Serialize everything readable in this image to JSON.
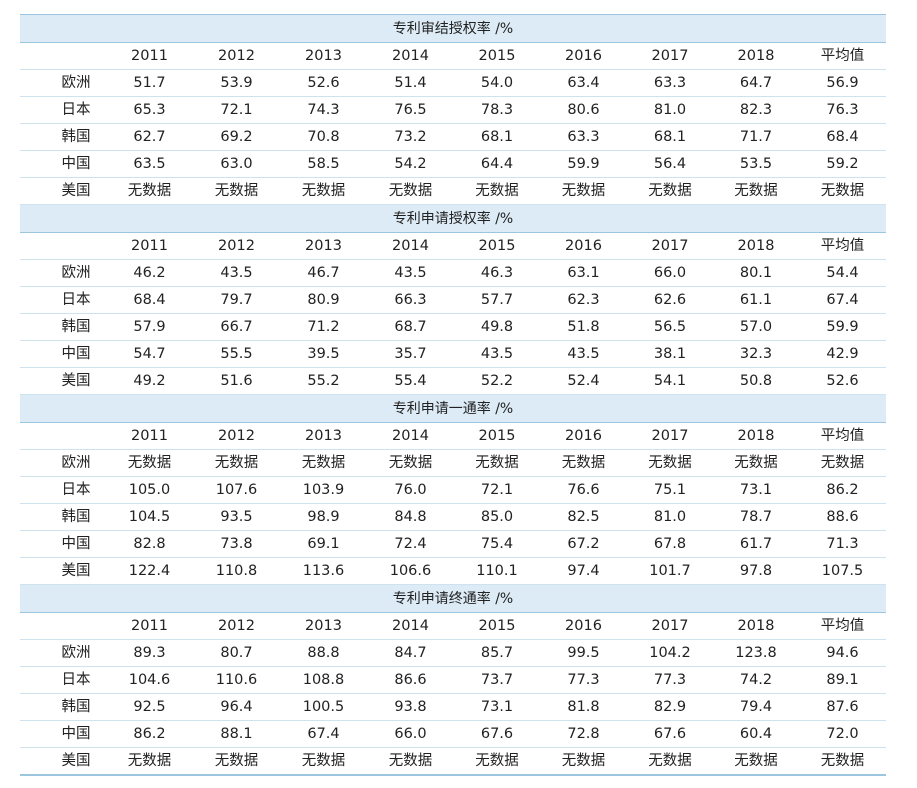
{
  "columns": [
    "2011",
    "2012",
    "2013",
    "2014",
    "2015",
    "2016",
    "2017",
    "2018",
    "平均值"
  ],
  "sections": [
    {
      "title": "专利审结授权率 /%",
      "rows": [
        {
          "region": "欧洲",
          "values": [
            "51.7",
            "53.9",
            "52.6",
            "51.4",
            "54.0",
            "63.4",
            "63.3",
            "64.7",
            "56.9"
          ]
        },
        {
          "region": "日本",
          "values": [
            "65.3",
            "72.1",
            "74.3",
            "76.5",
            "78.3",
            "80.6",
            "81.0",
            "82.3",
            "76.3"
          ]
        },
        {
          "region": "韩国",
          "values": [
            "62.7",
            "69.2",
            "70.8",
            "73.2",
            "68.1",
            "63.3",
            "68.1",
            "71.7",
            "68.4"
          ]
        },
        {
          "region": "中国",
          "values": [
            "63.5",
            "63.0",
            "58.5",
            "54.2",
            "64.4",
            "59.9",
            "56.4",
            "53.5",
            "59.2"
          ]
        },
        {
          "region": "美国",
          "values": [
            "无数据",
            "无数据",
            "无数据",
            "无数据",
            "无数据",
            "无数据",
            "无数据",
            "无数据",
            "无数据"
          ]
        }
      ]
    },
    {
      "title": "专利申请授权率 /%",
      "rows": [
        {
          "region": "欧洲",
          "values": [
            "46.2",
            "43.5",
            "46.7",
            "43.5",
            "46.3",
            "63.1",
            "66.0",
            "80.1",
            "54.4"
          ]
        },
        {
          "region": "日本",
          "values": [
            "68.4",
            "79.7",
            "80.9",
            "66.3",
            "57.7",
            "62.3",
            "62.6",
            "61.1",
            "67.4"
          ]
        },
        {
          "region": "韩国",
          "values": [
            "57.9",
            "66.7",
            "71.2",
            "68.7",
            "49.8",
            "51.8",
            "56.5",
            "57.0",
            "59.9"
          ]
        },
        {
          "region": "中国",
          "values": [
            "54.7",
            "55.5",
            "39.5",
            "35.7",
            "43.5",
            "43.5",
            "38.1",
            "32.3",
            "42.9"
          ]
        },
        {
          "region": "美国",
          "values": [
            "49.2",
            "51.6",
            "55.2",
            "55.4",
            "52.2",
            "52.4",
            "54.1",
            "50.8",
            "52.6"
          ]
        }
      ]
    },
    {
      "title": "专利申请一通率 /%",
      "rows": [
        {
          "region": "欧洲",
          "values": [
            "无数据",
            "无数据",
            "无数据",
            "无数据",
            "无数据",
            "无数据",
            "无数据",
            "无数据",
            "无数据"
          ]
        },
        {
          "region": "日本",
          "values": [
            "105.0",
            "107.6",
            "103.9",
            "76.0",
            "72.1",
            "76.6",
            "75.1",
            "73.1",
            "86.2"
          ]
        },
        {
          "region": "韩国",
          "values": [
            "104.5",
            "93.5",
            "98.9",
            "84.8",
            "85.0",
            "82.5",
            "81.0",
            "78.7",
            "88.6"
          ]
        },
        {
          "region": "中国",
          "values": [
            "82.8",
            "73.8",
            "69.1",
            "72.4",
            "75.4",
            "67.2",
            "67.8",
            "61.7",
            "71.3"
          ]
        },
        {
          "region": "美国",
          "values": [
            "122.4",
            "110.8",
            "113.6",
            "106.6",
            "110.1",
            "97.4",
            "101.7",
            "97.8",
            "107.5"
          ]
        }
      ]
    },
    {
      "title": "专利申请终通率 /%",
      "rows": [
        {
          "region": "欧洲",
          "values": [
            "89.3",
            "80.7",
            "88.8",
            "84.7",
            "85.7",
            "99.5",
            "104.2",
            "123.8",
            "94.6"
          ]
        },
        {
          "region": "日本",
          "values": [
            "104.6",
            "110.6",
            "108.8",
            "86.6",
            "73.7",
            "77.3",
            "77.3",
            "74.2",
            "89.1"
          ]
        },
        {
          "region": "韩国",
          "values": [
            "92.5",
            "96.4",
            "100.5",
            "93.8",
            "73.1",
            "81.8",
            "82.9",
            "79.4",
            "87.6"
          ]
        },
        {
          "region": "中国",
          "values": [
            "86.2",
            "88.1",
            "67.4",
            "66.0",
            "67.6",
            "72.8",
            "67.6",
            "60.4",
            "72.0"
          ]
        },
        {
          "region": "美国",
          "values": [
            "无数据",
            "无数据",
            "无数据",
            "无数据",
            "无数据",
            "无数据",
            "无数据",
            "无数据",
            "无数据"
          ]
        }
      ]
    }
  ]
}
